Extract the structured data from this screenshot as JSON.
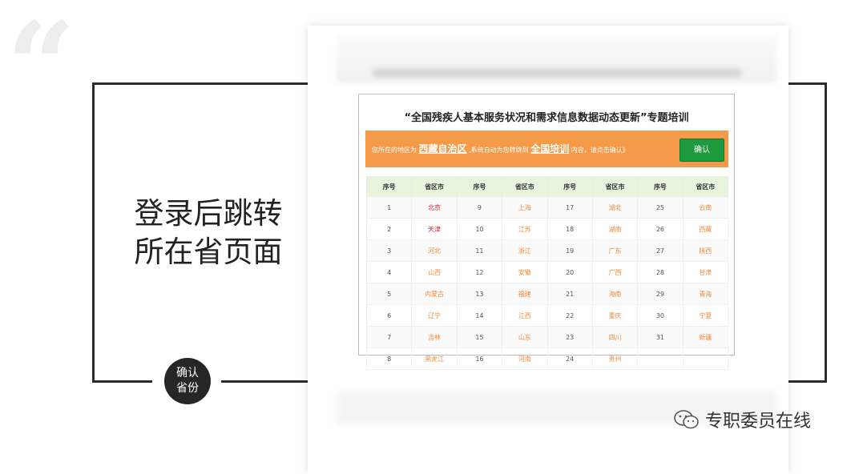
{
  "left_panel": {
    "headline_line1": "登录后跳转",
    "headline_line2": "所在省页面",
    "badge_line1": "确认",
    "badge_line2": "省份"
  },
  "inner": {
    "title": "“全国残疾人基本服务状况和需求信息数据动态更新”专题培训",
    "banner": {
      "pre": "您所在的地区为",
      "region": "西藏自治区",
      "mid": ",系统自动为您转跳到",
      "target": "全国培训",
      "post": "内容，请点击确认》",
      "confirm_label": "确认"
    },
    "table": {
      "headers": [
        "序号",
        "省区市",
        "序号",
        "省区市",
        "序号",
        "省区市",
        "序号",
        "省区市"
      ],
      "rows": [
        [
          "1",
          "北京",
          "9",
          "上海",
          "17",
          "湖北",
          "25",
          "云南"
        ],
        [
          "2",
          "天津",
          "10",
          "江苏",
          "18",
          "湖南",
          "26",
          "西藏"
        ],
        [
          "3",
          "河北",
          "11",
          "浙江",
          "19",
          "广东",
          "27",
          "陕西"
        ],
        [
          "4",
          "山西",
          "12",
          "安徽",
          "20",
          "广西",
          "28",
          "甘肃"
        ],
        [
          "5",
          "内蒙古",
          "13",
          "福建",
          "21",
          "海南",
          "29",
          "青海"
        ],
        [
          "6",
          "辽宁",
          "14",
          "江西",
          "22",
          "重庆",
          "30",
          "宁夏"
        ],
        [
          "7",
          "吉林",
          "15",
          "山东",
          "23",
          "四川",
          "31",
          "新疆"
        ],
        [
          "8",
          "黑龙江",
          "16",
          "河南",
          "24",
          "贵州",
          "",
          ""
        ]
      ]
    }
  },
  "watermark": {
    "text": "专职委员在线",
    "icon": "wechat-icon"
  },
  "colors": {
    "banner": "#f59a48",
    "confirm": "#1e9a3e",
    "table_header": "#e6f5dc",
    "province_link": "#f08a3c",
    "highlight": "#e0222a"
  }
}
